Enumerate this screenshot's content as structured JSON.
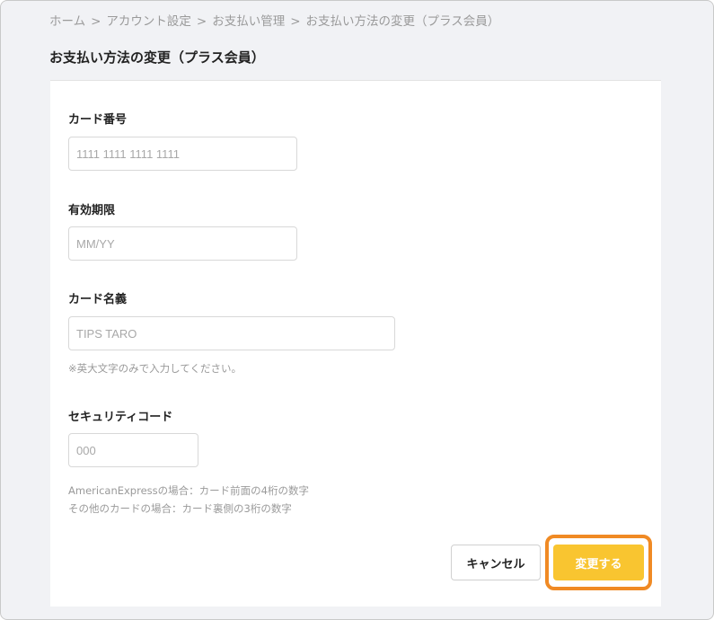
{
  "breadcrumb": {
    "items": [
      "ホーム",
      "アカウント設定",
      "お支払い管理",
      "お支払い方法の変更（プラス会員）"
    ],
    "separator": ">"
  },
  "page_title": "お支払い方法の変更（プラス会員）",
  "form": {
    "card_number": {
      "label": "カード番号",
      "placeholder": "1111 1111 1111 1111",
      "value": ""
    },
    "expiry": {
      "label": "有効期限",
      "placeholder": "MM/YY",
      "value": ""
    },
    "card_name": {
      "label": "カード名義",
      "placeholder": "TIPS TARO",
      "value": "",
      "note": "※英大文字のみで入力してください。"
    },
    "security_code": {
      "label": "セキュリティコード",
      "placeholder": "000",
      "value": "",
      "note_line1": "AmericanExpressの場合：カード前面の4桁の数字",
      "note_line2": "その他のカードの場合：カード裏側の3桁の数字"
    }
  },
  "buttons": {
    "cancel_label": "キャンセル",
    "submit_label": "変更する"
  },
  "colors": {
    "submit_bg": "#f9c530",
    "highlight_ring": "#f08a24",
    "page_bg": "#f1f2f5"
  }
}
